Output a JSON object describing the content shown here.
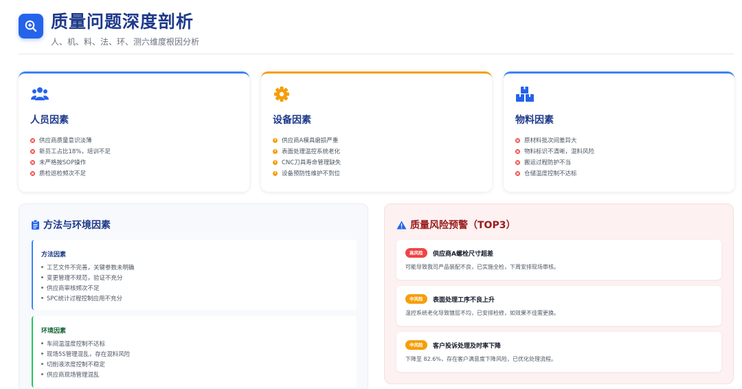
{
  "header": {
    "title": "质量问题深度剖析",
    "subtitle": "人、机、料、法、环、测六维度根因分析",
    "icon": "search-plus-icon"
  },
  "factors": [
    {
      "title": "人员因素",
      "icon": "users-icon",
      "accent": "#3b82f6",
      "bullet": "x-circle-icon",
      "items": [
        "供应商质量意识淡薄",
        "新员工占比18%，培训不足",
        "未严格按SOP操作",
        "质检巡检频次不足"
      ]
    },
    {
      "title": "设备因素",
      "icon": "gear-icon",
      "accent": "#f59e0b",
      "bullet": "warning-circle-icon",
      "items": [
        "供应商A模具磨损严重",
        "表面处理温控系统老化",
        "CNC刀具寿命管理缺失",
        "设备预防性维护不到位"
      ]
    },
    {
      "title": "物料因素",
      "icon": "boxes-icon",
      "accent": "#3b82f6",
      "bullet": "x-circle-icon",
      "items": [
        "原材料批次间差异大",
        "物料标识不清晰，混料风险",
        "搬运过程防护不当",
        "仓储温度控制不达标"
      ]
    }
  ],
  "method_env": {
    "title": "方法与环境因素",
    "icon": "clipboard-icon",
    "method": {
      "title": "方法因素",
      "items": [
        "工艺文件不完善，关键参数未明确",
        "变更管理不规范，验证不充分",
        "供应商审核频次不足",
        "SPC统计过程控制应用不充分"
      ]
    },
    "environment": {
      "title": "环境因素",
      "items": [
        "车间温湿度控制不达标",
        "现场5S管理混乱，存在混料风险",
        "切削液浓度控制不稳定",
        "供应商现场管理混乱"
      ]
    }
  },
  "risks": {
    "title": "质量风险预警（TOP3）",
    "icon": "warning-triangle-icon",
    "items": [
      {
        "level": "高风险",
        "type": "high",
        "name": "供应商A螺栓尺寸超差",
        "desc": "可能导致我司产品装配不良，已实施全检，下周安排现场审核。"
      },
      {
        "level": "中风险",
        "type": "mid",
        "name": "表面处理工序不良上升",
        "desc": "温控系统老化导致镀层不均，已安排检修，如效果不佳需更换。"
      },
      {
        "level": "中风险",
        "type": "mid",
        "name": "客户投诉处理及时率下降",
        "desc": "下降至 82.6%，存在客户满意度下降风险，已优化处理流程。"
      }
    ]
  },
  "colors": {
    "primary": "#2563eb",
    "title": "#1e3a8a",
    "warning": "#f59e0b",
    "danger": "#ef4444",
    "success": "#22c55e"
  }
}
